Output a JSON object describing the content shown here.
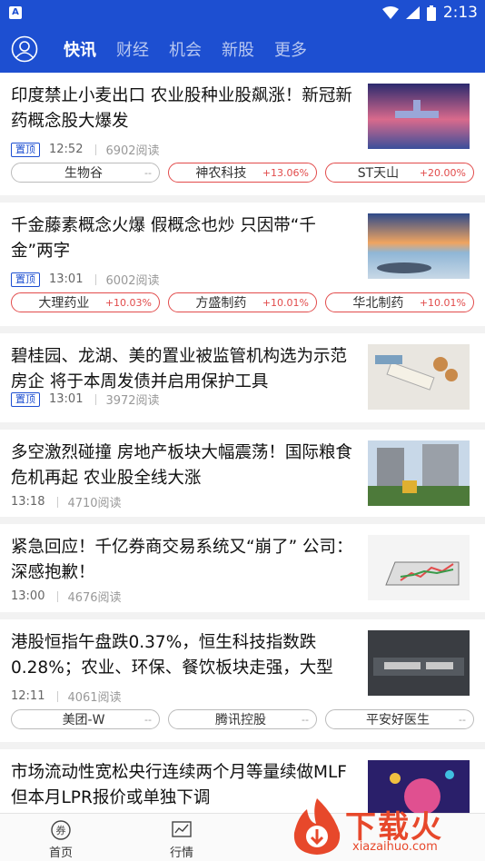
{
  "status": {
    "time": "2:13",
    "app_badge": "A"
  },
  "nav": {
    "tabs": [
      "快讯",
      "财经",
      "机会",
      "新股",
      "更多"
    ]
  },
  "pin_label": "置顶",
  "articles": [
    {
      "title": "印度禁止小麦出口 农业股种业股飙涨！新冠新药概念股大爆发",
      "pinned": true,
      "time": "12:52",
      "reads": "6902阅读",
      "stocks": [
        {
          "name": "生物谷",
          "change": "--"
        },
        {
          "name": "神农科技",
          "change": "+13.06%"
        },
        {
          "name": "ST天山",
          "change": "+20.00%"
        }
      ]
    },
    {
      "title": "千金藤素概念火爆 假概念也炒 只因带“千金”两字",
      "pinned": true,
      "time": "13:01",
      "reads": "6002阅读",
      "stocks": [
        {
          "name": "大理药业",
          "change": "+10.03%"
        },
        {
          "name": "方盛制药",
          "change": "+10.01%"
        },
        {
          "name": "华北制药",
          "change": "+10.01%"
        }
      ]
    },
    {
      "title": "碧桂园、龙湖、美的置业被监管机构选为示范房企 将于本周发债并启用保护工具",
      "pinned": true,
      "time": "13:01",
      "reads": "3972阅读",
      "stocks": []
    },
    {
      "title": "多空激烈碰撞 房地产板块大幅震荡！国际粮食危机再起 农业股全线大涨",
      "pinned": false,
      "time": "13:18",
      "reads": "4710阅读",
      "stocks": []
    },
    {
      "title": "紧急回应！千亿券商交易系统又“崩了” 公司：深感抱歉！",
      "pinned": false,
      "time": "13:00",
      "reads": "4676阅读",
      "stocks": []
    },
    {
      "title": "港股恒指午盘跌0.37%，恒生科技指数跌0.28%；农业、环保、餐饮板块走强，大型",
      "pinned": false,
      "time": "12:11",
      "reads": "4061阅读",
      "stocks": [
        {
          "name": "美团-W",
          "change": "--"
        },
        {
          "name": "腾讯控股",
          "change": "--"
        },
        {
          "name": "平安好医生",
          "change": "--"
        }
      ]
    },
    {
      "title": "市场流动性宽松央行连续两个月等量续做MLF 但本月LPR报价或单独下调",
      "pinned": false,
      "time": "",
      "reads": "",
      "stocks": []
    }
  ],
  "bottom_nav": [
    {
      "label": "首页"
    },
    {
      "label": "行情"
    }
  ],
  "brand": {
    "name": "下载火",
    "url": "xiazaihuo.com"
  },
  "colors": {
    "primary": "#1d4fd1",
    "up": "#e24b4b"
  }
}
